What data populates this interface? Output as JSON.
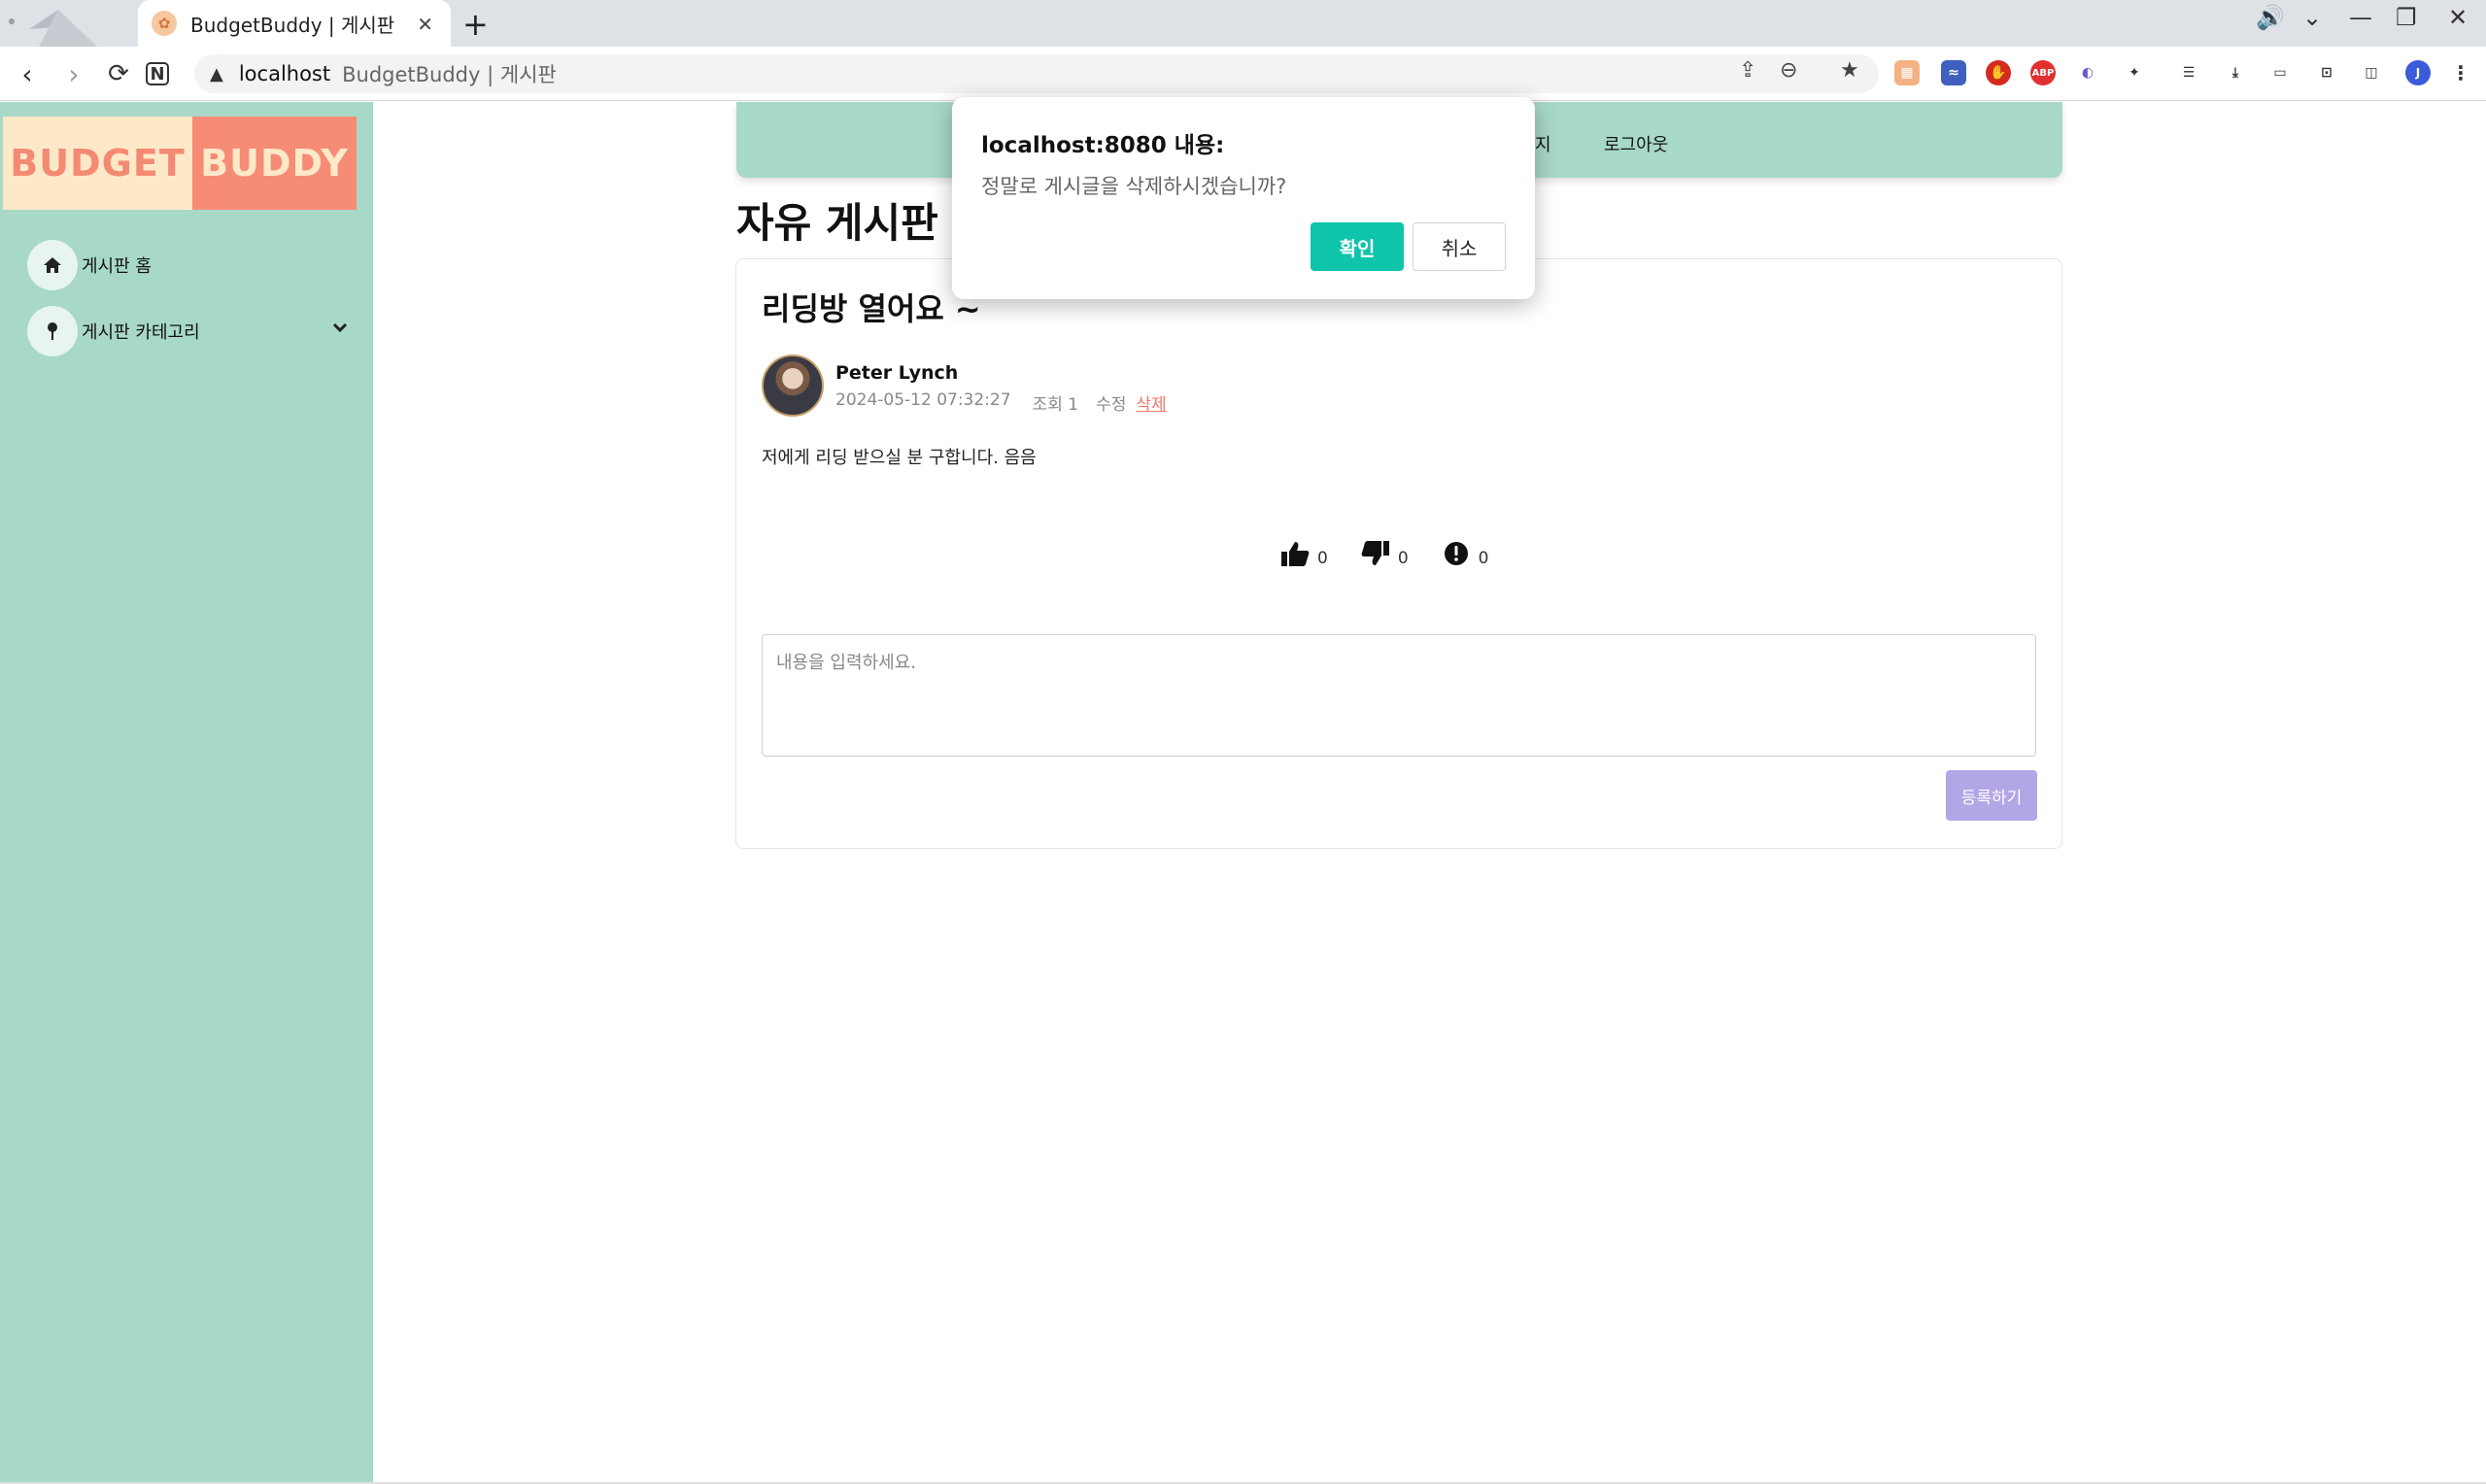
{
  "browser": {
    "tab_title": "BudgetBuddy | 게시판",
    "tab_close": "✕",
    "new_tab": "+",
    "url_host": "localhost",
    "url_path": "BudgetBuddy | 게시판",
    "back": "‹",
    "forward": "›",
    "reload": "⟳",
    "notion": "N",
    "extensions": [
      "ABP",
      "J"
    ]
  },
  "sidebar": {
    "logo_left": "BUDGET",
    "logo_right": "BUDDY",
    "items": [
      {
        "label": "게시판 홈",
        "icon": "home-icon"
      },
      {
        "label": "게시판 카테고리",
        "icon": "pin-icon",
        "chevron": "⌄"
      }
    ]
  },
  "topnav": {
    "links": [
      "지",
      "로그아웃"
    ]
  },
  "page": {
    "board_title": "자유 게시판"
  },
  "post": {
    "title": "리딩방 열어요 ~",
    "author": "Peter Lynch",
    "date": "2024-05-12 07:32:27",
    "views": "조회 1",
    "edit": "수정",
    "delete": "삭제",
    "body": "저에게 리딩 받으실 분 구합니다. 음음",
    "reactions": [
      {
        "icon": "thumbs-up-icon",
        "count": "0"
      },
      {
        "icon": "thumbs-down-icon",
        "count": "0"
      },
      {
        "icon": "exclamation-circle-icon",
        "count": "0"
      }
    ]
  },
  "comment": {
    "placeholder": "내용을 입력하세요.",
    "submit_label": "등록하기"
  },
  "dialog": {
    "title": "localhost:8080 내용:",
    "message": "정말로 게시글을 삭제하시겠습니까?",
    "ok_label": "확인",
    "cancel_label": "취소"
  },
  "colors": {
    "sidebar_bg": "#a8d8c8",
    "logo_left_bg": "#fde9c8",
    "logo_right_bg": "#f68b76",
    "confirm_btn": "#0ec4ab",
    "submit_btn": "#b3a6e6",
    "delete_link": "#f0776c"
  }
}
